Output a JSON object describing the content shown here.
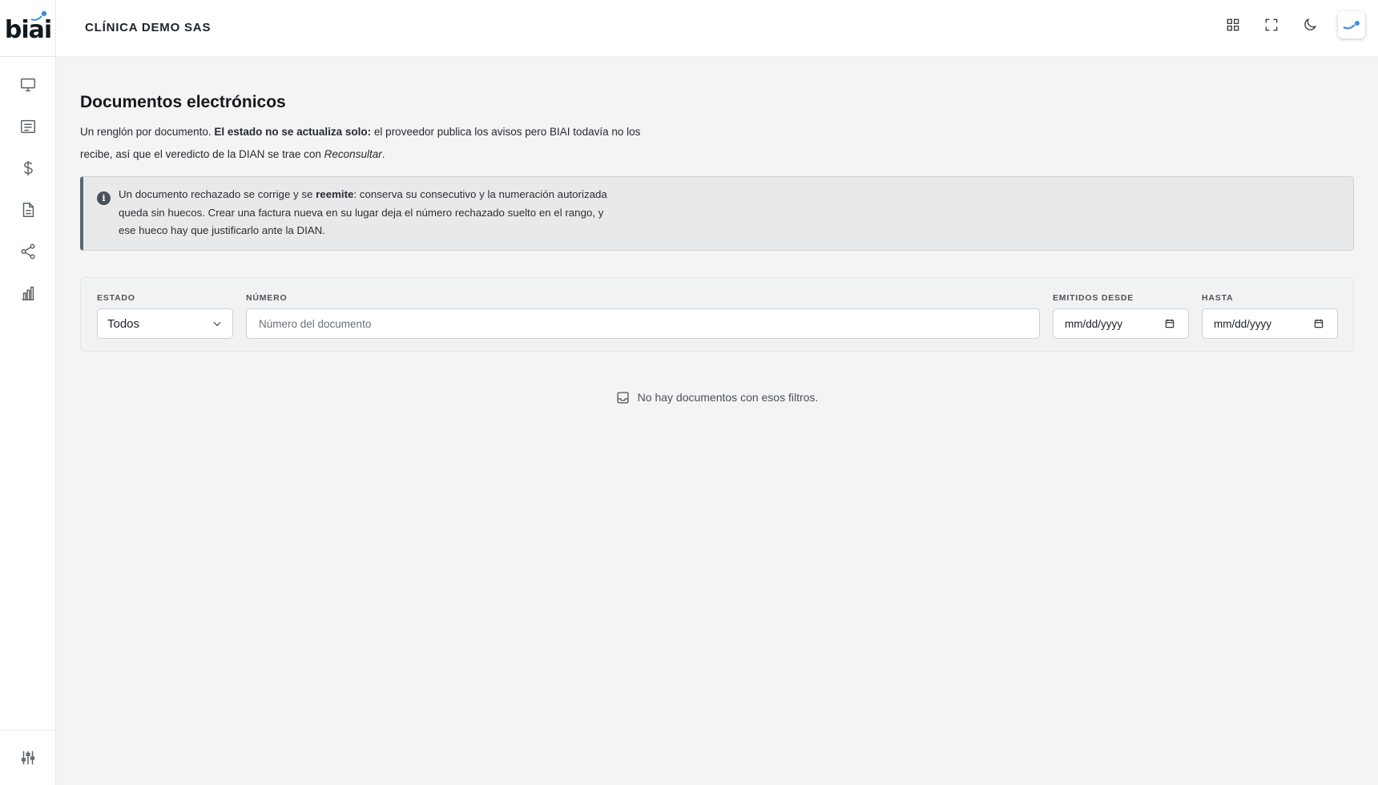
{
  "brand": {
    "logo_text": "biai",
    "accent": "#3b8fd9"
  },
  "sidebar": {
    "items": [
      {
        "name": "dashboard",
        "icon": "monitor-icon"
      },
      {
        "name": "messages",
        "icon": "receipt-icon"
      },
      {
        "name": "billing",
        "icon": "dollar-icon"
      },
      {
        "name": "documents",
        "icon": "document-icon"
      },
      {
        "name": "integrations",
        "icon": "share-icon"
      },
      {
        "name": "reports",
        "icon": "bar-chart-icon"
      }
    ],
    "bottom_icon": "sliders-icon"
  },
  "header": {
    "company": "CLÍNICA DEMO SAS",
    "actions": [
      "grid-icon",
      "fullscreen-icon",
      "moon-icon",
      "avatar"
    ]
  },
  "main": {
    "title": "Documentos electrónicos",
    "lead": {
      "part1": "Un renglón por documento. ",
      "bold": "El estado no se actualiza solo:",
      "part2": " el proveedor publica los avisos pero BIAI todavía no los recibe, así que el veredicto de la DIAN se trae con ",
      "italic": "Reconsultar",
      "part3": "."
    },
    "callout": {
      "part1": "Un documento rechazado se corrige y se ",
      "bold": "reemite",
      "part2": ": conserva su consecutivo y la numeración autorizada queda sin huecos. Crear una factura nueva en su lugar deja el número rechazado suelto en el rango, y ese hueco hay que justificarlo ante la DIAN."
    },
    "filters": {
      "estado_label": "ESTADO",
      "estado_value": "Todos",
      "numero_label": "NÚMERO",
      "numero_placeholder": "Número del documento",
      "desde_label": "EMITIDOS DESDE",
      "desde_value": "mm/dd/yyyy",
      "hasta_label": "HASTA",
      "hasta_value": "mm/dd/yyyy"
    },
    "empty_message": "No hay documentos con esos filtros."
  }
}
